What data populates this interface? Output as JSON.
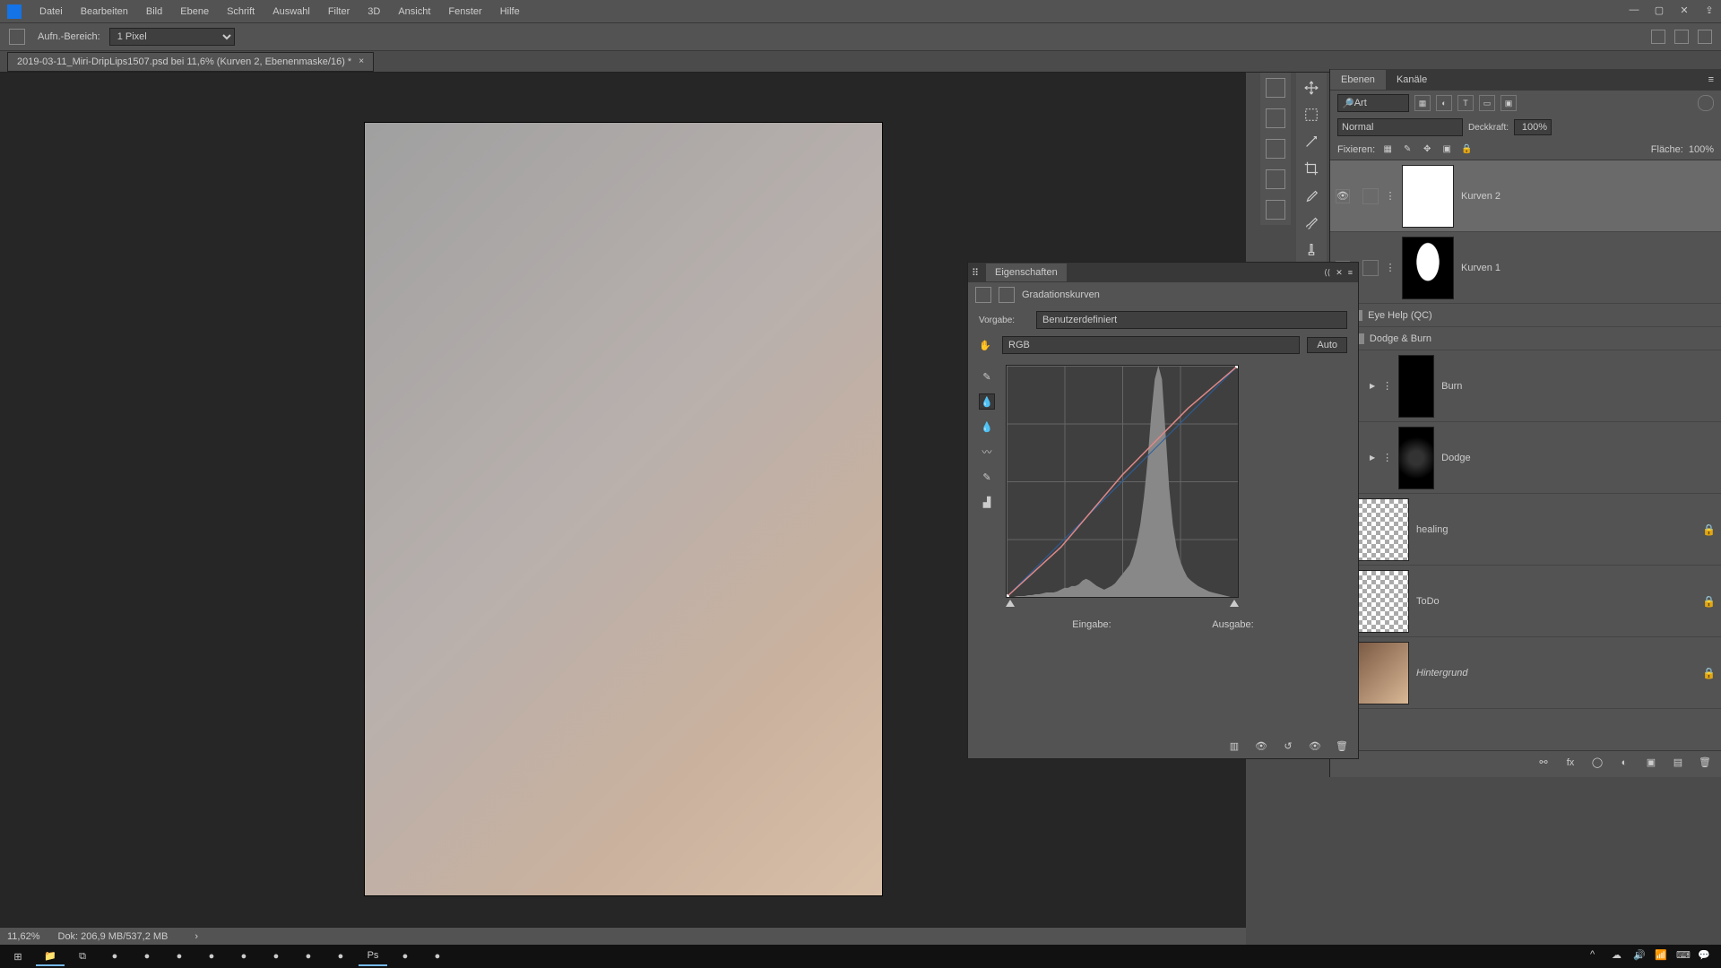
{
  "menu": [
    "Datei",
    "Bearbeiten",
    "Bild",
    "Ebene",
    "Schrift",
    "Auswahl",
    "Filter",
    "3D",
    "Ansicht",
    "Fenster",
    "Hilfe"
  ],
  "options": {
    "label": "Aufn.-Bereich:",
    "value": "1 Pixel"
  },
  "doc_tab": "2019-03-11_Miri-DripLips1507.psd bei 11,6%  (Kurven 2, Ebenenmaske/16) *",
  "status": {
    "zoom": "11,62%",
    "doc": "Dok: 206,9 MB/537,2 MB"
  },
  "layers_panel": {
    "tabs": [
      "Ebenen",
      "Kanäle"
    ],
    "filter": "Art",
    "blend": "Normal",
    "opacity_label": "Deckkraft:",
    "opacity": "100%",
    "lock_label": "Fixieren:",
    "fill_label": "Fläche:",
    "fill": "100%",
    "items": [
      {
        "name": "Kurven 2",
        "type": "adj",
        "mask": "white",
        "selected": true
      },
      {
        "name": "Kurven 1",
        "type": "adj",
        "mask": "silhouette"
      },
      {
        "name": "Eye Help (QC)",
        "type": "group",
        "open": false
      },
      {
        "name": "Dodge & Burn",
        "type": "group",
        "open": true,
        "children": [
          {
            "name": "Burn",
            "thumb": "black"
          },
          {
            "name": "Dodge",
            "thumb": "dodge"
          }
        ]
      },
      {
        "name": "healing",
        "type": "checker",
        "locked": true
      },
      {
        "name": "ToDo",
        "type": "checker",
        "locked": true
      },
      {
        "name": "Hintergrund",
        "type": "portrait",
        "locked": true,
        "italic": true
      }
    ]
  },
  "properties": {
    "title": "Eigenschaften",
    "header": "Gradationskurven",
    "preset_label": "Vorgabe:",
    "preset": "Benutzerdefiniert",
    "channel": "RGB",
    "auto": "Auto",
    "input_label": "Eingabe:",
    "output_label": "Ausgabe:"
  },
  "chart_data": {
    "type": "curve",
    "channel": "RGB",
    "xlim": [
      0,
      255
    ],
    "ylim": [
      0,
      255
    ],
    "baseline": [
      [
        0,
        0
      ],
      [
        255,
        255
      ]
    ],
    "curve": [
      [
        0,
        0
      ],
      [
        60,
        55
      ],
      [
        128,
        135
      ],
      [
        200,
        208
      ],
      [
        255,
        255
      ]
    ],
    "histogram": [
      0,
      0,
      0,
      1,
      1,
      1,
      2,
      2,
      3,
      3,
      4,
      5,
      5,
      5,
      6,
      8,
      10,
      10,
      12,
      12,
      14,
      18,
      20,
      18,
      15,
      12,
      10,
      8,
      10,
      12,
      15,
      20,
      25,
      30,
      35,
      45,
      60,
      80,
      110,
      150,
      200,
      240,
      255,
      240,
      180,
      120,
      80,
      55,
      40,
      30,
      22,
      18,
      15,
      12,
      10,
      8,
      6,
      5,
      4,
      3,
      2,
      1,
      0,
      0
    ]
  }
}
